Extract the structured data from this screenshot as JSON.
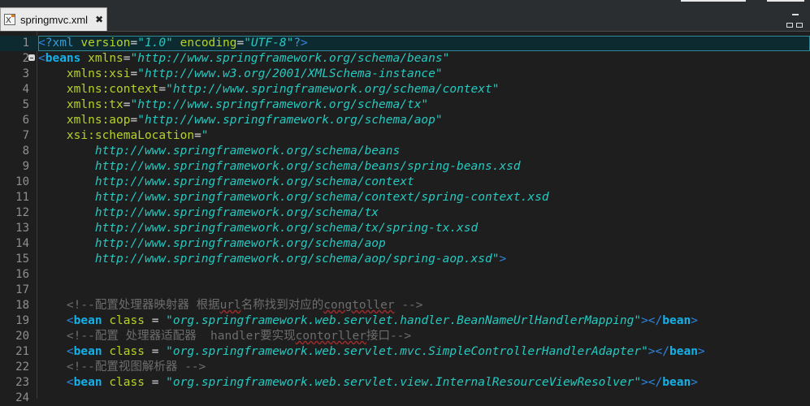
{
  "tab": {
    "title": "springmvc.xml",
    "close": "✖",
    "icon": "xml-file-icon"
  },
  "colors": {
    "background": "#1e1e1e",
    "tag": "#14b0e8",
    "attribute": "#b6d22a",
    "value": "#25c9c0",
    "comment": "#6d6d6d"
  },
  "lines": [
    {
      "n": "1",
      "current": true,
      "parts": [
        [
          "br",
          "<"
        ],
        [
          "pi",
          "?xml "
        ],
        [
          "an",
          "version"
        ],
        [
          "pl",
          "="
        ],
        [
          "av",
          "\"1.0\" "
        ],
        [
          "an",
          "encoding"
        ],
        [
          "pl",
          "="
        ],
        [
          "av",
          "\"UTF-8\""
        ],
        [
          "pi",
          "?"
        ],
        [
          "br",
          ">"
        ]
      ]
    },
    {
      "n": "2",
      "fold": true,
      "parts": [
        [
          "br",
          "<"
        ],
        [
          "tg",
          "beans "
        ],
        [
          "an",
          "xmlns"
        ],
        [
          "pl",
          "="
        ],
        [
          "av",
          "\"http://www.springframework.org/schema/beans\""
        ]
      ]
    },
    {
      "n": "3",
      "parts": [
        [
          "pl",
          "    "
        ],
        [
          "an",
          "xmlns:xsi"
        ],
        [
          "pl",
          "="
        ],
        [
          "av",
          "\"http://www.w3.org/2001/XMLSchema-instance\""
        ]
      ]
    },
    {
      "n": "4",
      "parts": [
        [
          "pl",
          "    "
        ],
        [
          "an",
          "xmlns:context"
        ],
        [
          "pl",
          "="
        ],
        [
          "av",
          "\"http://www.springframework.org/schema/context\""
        ]
      ]
    },
    {
      "n": "5",
      "parts": [
        [
          "pl",
          "    "
        ],
        [
          "an",
          "xmlns:tx"
        ],
        [
          "pl",
          "="
        ],
        [
          "av",
          "\"http://www.springframework.org/schema/tx\""
        ]
      ]
    },
    {
      "n": "6",
      "parts": [
        [
          "pl",
          "    "
        ],
        [
          "an",
          "xmlns:aop"
        ],
        [
          "pl",
          "="
        ],
        [
          "av",
          "\"http://www.springframework.org/schema/aop\""
        ]
      ]
    },
    {
      "n": "7",
      "parts": [
        [
          "pl",
          "    "
        ],
        [
          "an",
          "xsi:schemaLocation"
        ],
        [
          "pl",
          "="
        ],
        [
          "av",
          "\""
        ]
      ]
    },
    {
      "n": "8",
      "parts": [
        [
          "pl",
          "        "
        ],
        [
          "av",
          "http://www.springframework.org/schema/beans"
        ]
      ]
    },
    {
      "n": "9",
      "parts": [
        [
          "pl",
          "        "
        ],
        [
          "av",
          "http://www.springframework.org/schema/beans/spring-beans.xsd"
        ]
      ]
    },
    {
      "n": "10",
      "parts": [
        [
          "pl",
          "        "
        ],
        [
          "av",
          "http://www.springframework.org/schema/context"
        ]
      ]
    },
    {
      "n": "11",
      "parts": [
        [
          "pl",
          "        "
        ],
        [
          "av",
          "http://www.springframework.org/schema/context/spring-context.xsd"
        ]
      ]
    },
    {
      "n": "12",
      "parts": [
        [
          "pl",
          "        "
        ],
        [
          "av",
          "http://www.springframework.org/schema/tx"
        ]
      ]
    },
    {
      "n": "13",
      "parts": [
        [
          "pl",
          "        "
        ],
        [
          "av",
          "http://www.springframework.org/schema/tx/spring-tx.xsd"
        ]
      ]
    },
    {
      "n": "14",
      "parts": [
        [
          "pl",
          "        "
        ],
        [
          "av",
          "http://www.springframework.org/schema/aop"
        ]
      ]
    },
    {
      "n": "15",
      "parts": [
        [
          "pl",
          "        "
        ],
        [
          "av",
          "http://www.springframework.org/schema/aop/spring-aop.xsd\""
        ],
        [
          "br",
          ">"
        ]
      ]
    },
    {
      "n": "16",
      "parts": []
    },
    {
      "n": "17",
      "parts": []
    },
    {
      "n": "18",
      "parts": [
        [
          "pl",
          "    "
        ],
        [
          "cm",
          "<!--配置处理器映射器 根据"
        ],
        [
          "cmsq",
          "url"
        ],
        [
          "cm",
          "名称找到对应的"
        ],
        [
          "cmsq",
          "congtoller"
        ],
        [
          "cm",
          " -->"
        ]
      ]
    },
    {
      "n": "19",
      "parts": [
        [
          "pl",
          "    "
        ],
        [
          "br",
          "<"
        ],
        [
          "tg",
          "bean "
        ],
        [
          "an",
          "class"
        ],
        [
          "pl",
          " = "
        ],
        [
          "av",
          "\"org.springframework.web.servlet.handler.BeanNameUrlHandlerMapping\""
        ],
        [
          "br",
          "></"
        ],
        [
          "tg",
          "bean"
        ],
        [
          "br",
          ">"
        ]
      ]
    },
    {
      "n": "20",
      "parts": [
        [
          "pl",
          "    "
        ],
        [
          "cm",
          "<!--配置 处理器适配器  handler要实现"
        ],
        [
          "cmsq",
          "contorller"
        ],
        [
          "cm",
          "接口-->"
        ]
      ]
    },
    {
      "n": "21",
      "parts": [
        [
          "pl",
          "    "
        ],
        [
          "br",
          "<"
        ],
        [
          "tg",
          "bean "
        ],
        [
          "an",
          "class"
        ],
        [
          "pl",
          " = "
        ],
        [
          "av",
          "\"org.springframework.web.servlet.mvc.SimpleControllerHandlerAdapter\""
        ],
        [
          "br",
          "></"
        ],
        [
          "tg",
          "bean"
        ],
        [
          "br",
          ">"
        ]
      ]
    },
    {
      "n": "22",
      "parts": [
        [
          "pl",
          "    "
        ],
        [
          "cm",
          "<!--配置视图解析器 -->"
        ]
      ]
    },
    {
      "n": "23",
      "parts": [
        [
          "pl",
          "    "
        ],
        [
          "br",
          "<"
        ],
        [
          "tg",
          "bean "
        ],
        [
          "an",
          "class"
        ],
        [
          "pl",
          " = "
        ],
        [
          "av",
          "\"org.springframework.web.servlet.view.InternalResourceViewResolver\""
        ],
        [
          "br",
          "></"
        ],
        [
          "tg",
          "bean"
        ],
        [
          "br",
          ">"
        ]
      ]
    },
    {
      "n": "24",
      "parts": []
    }
  ]
}
